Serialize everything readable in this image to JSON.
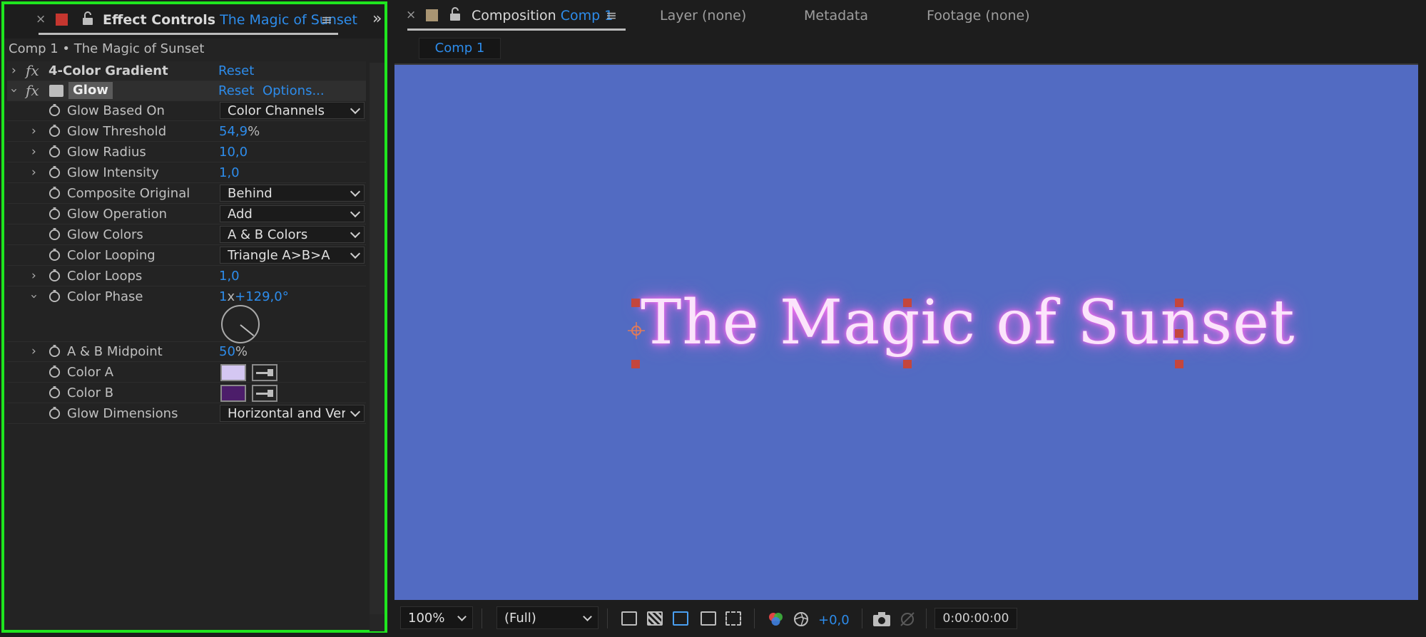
{
  "effect_controls": {
    "tab": {
      "close": "×",
      "title": "Effect Controls",
      "layer": "The Magic of Sunset",
      "menu": "≡",
      "overflow": "»"
    },
    "comp_line": "Comp 1 • The Magic of Sunset",
    "effects": [
      {
        "name": "4-Color Gradient",
        "reset": "Reset"
      },
      {
        "name": "Glow",
        "reset": "Reset",
        "options": "Options..."
      }
    ],
    "params": {
      "glow_based_on": {
        "label": "Glow Based On",
        "value": "Color Channels"
      },
      "glow_threshold": {
        "label": "Glow Threshold",
        "value": "54,9",
        "unit": "%"
      },
      "glow_radius": {
        "label": "Glow Radius",
        "value": "10,0"
      },
      "glow_intensity": {
        "label": "Glow Intensity",
        "value": "1,0"
      },
      "composite_original": {
        "label": "Composite Original",
        "value": "Behind"
      },
      "glow_operation": {
        "label": "Glow Operation",
        "value": "Add"
      },
      "glow_colors": {
        "label": "Glow Colors",
        "value": "A & B Colors"
      },
      "color_looping": {
        "label": "Color Looping",
        "value": "Triangle A>B>A"
      },
      "color_loops": {
        "label": "Color Loops",
        "value": "1,0"
      },
      "color_phase": {
        "label": "Color Phase",
        "rev": "1",
        "x": "x",
        "deg": "+129,0°"
      },
      "ab_midpoint": {
        "label": "A & B Midpoint",
        "value": "50",
        "unit": "%"
      },
      "color_a": {
        "label": "Color A",
        "swatch": "#d4c7f2"
      },
      "color_b": {
        "label": "Color B",
        "swatch": "#4c1d6a"
      },
      "glow_dimensions": {
        "label": "Glow Dimensions",
        "value": "Horizontal and Verti"
      }
    }
  },
  "composition": {
    "tabs": {
      "close": "×",
      "composition": "Composition",
      "comp_name": "Comp 1",
      "menu": "≡",
      "layer": "Layer (none)",
      "metadata": "Metadata",
      "footage": "Footage (none)"
    },
    "sub_tab": "Comp 1",
    "headline": "The Magic of Sunset",
    "viewer_bg": "#526bc2",
    "bottom": {
      "zoom": "100%",
      "resolution": "(Full)",
      "exposure": "+0,0",
      "timecode": "0:00:00:00"
    }
  }
}
